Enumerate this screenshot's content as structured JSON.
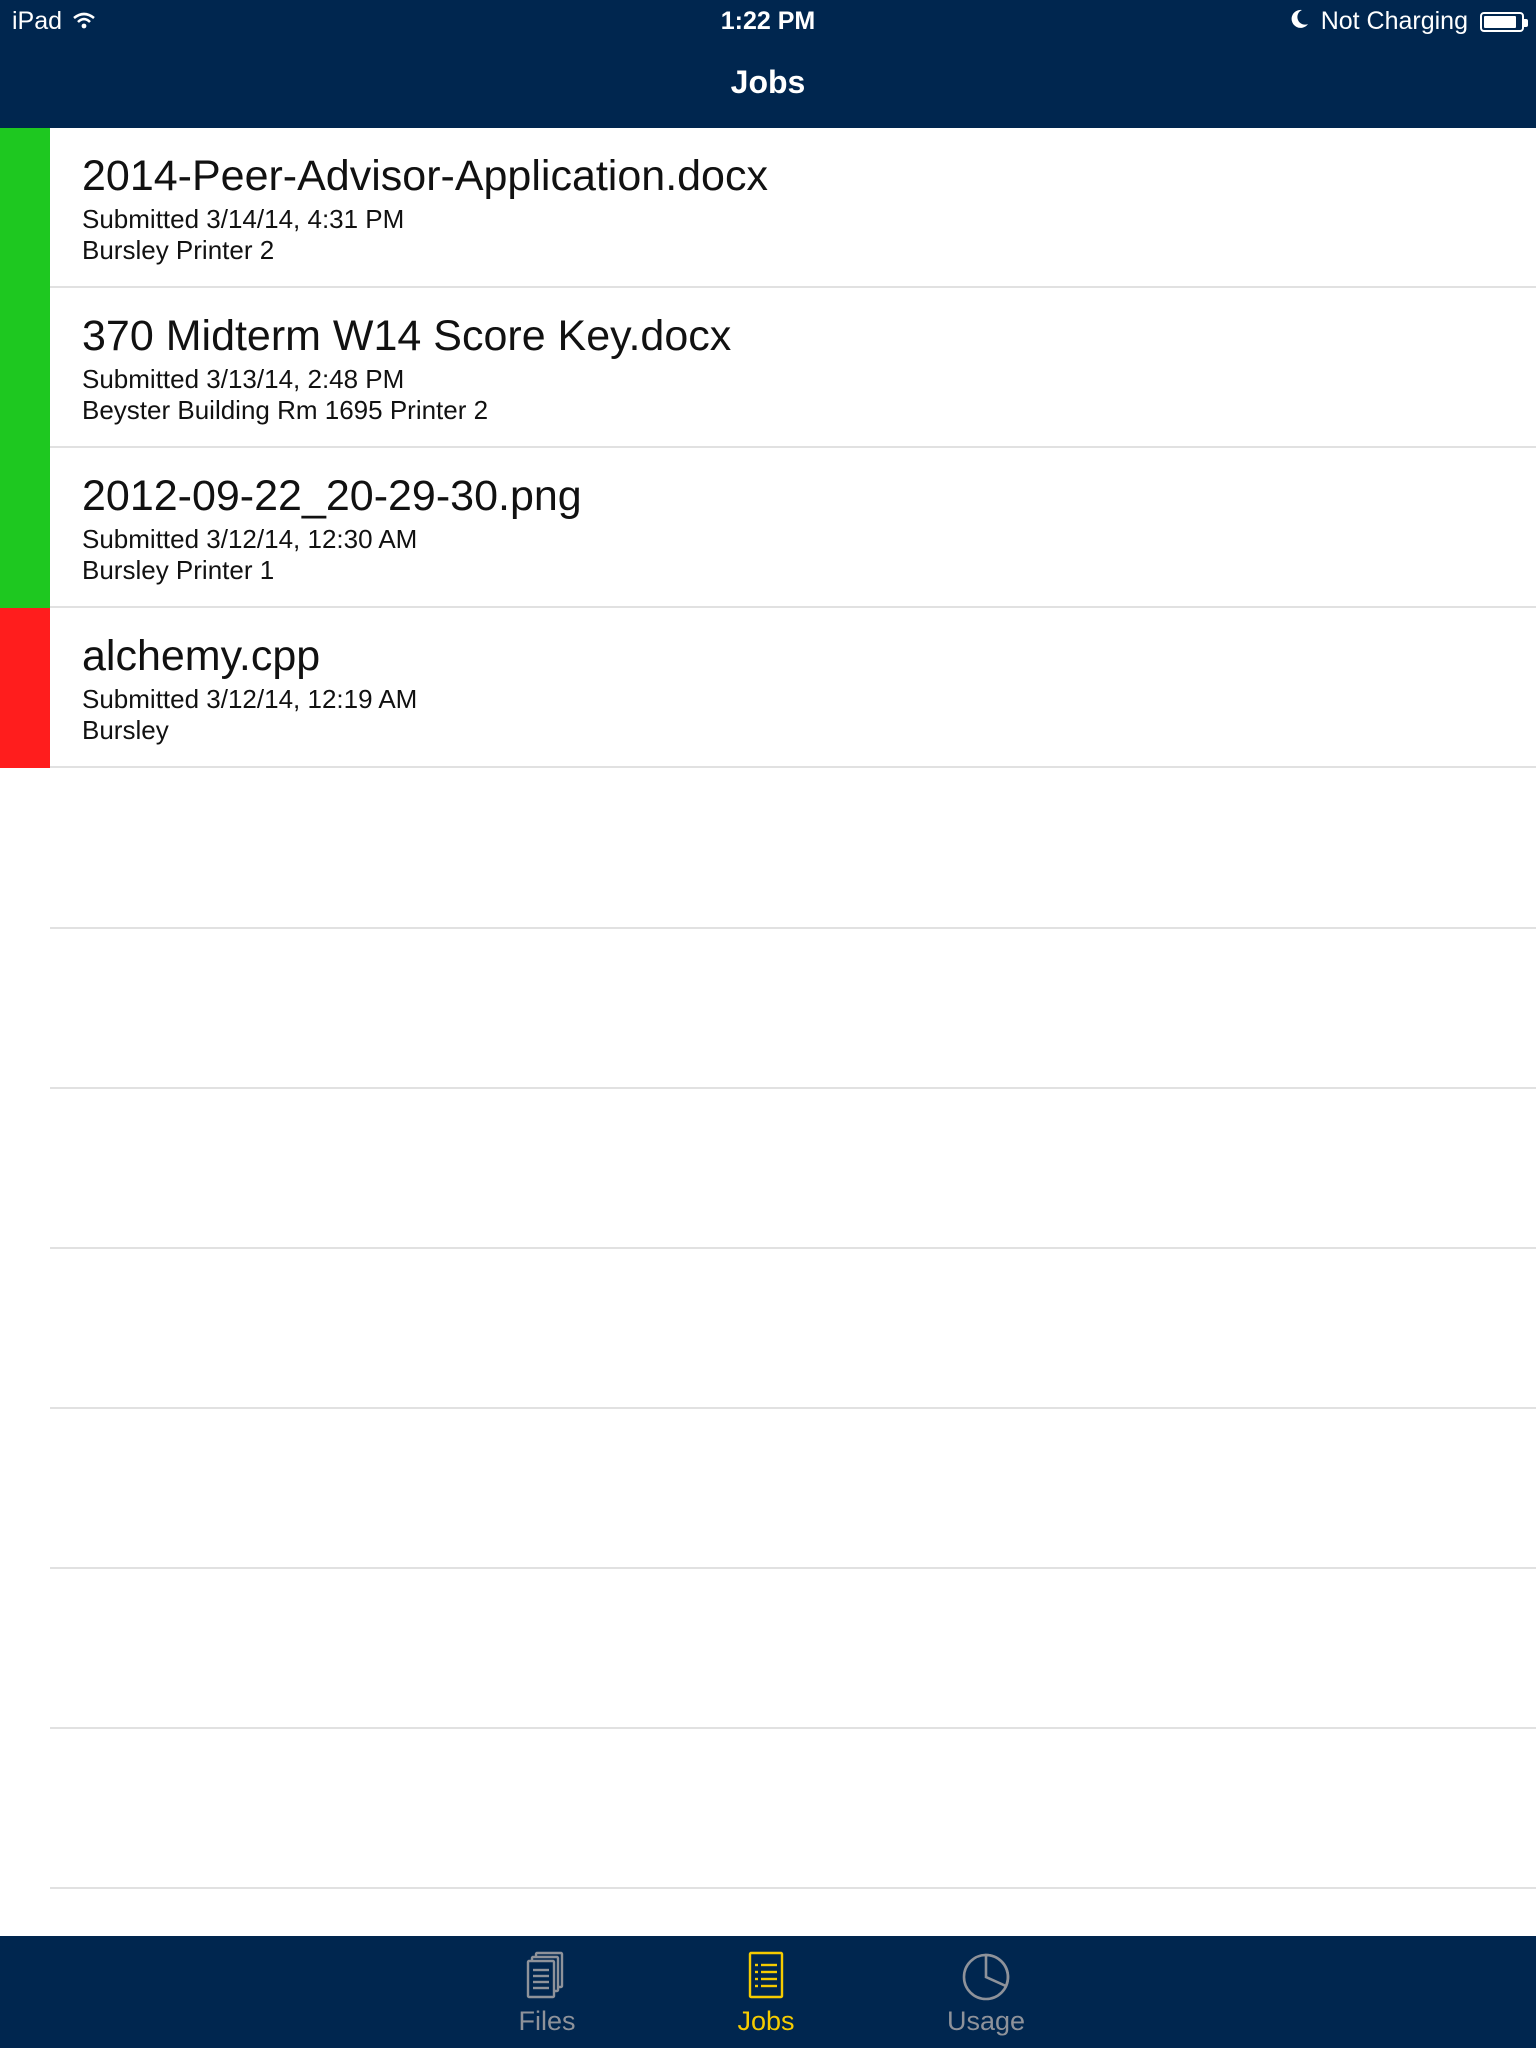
{
  "status_bar": {
    "device": "iPad",
    "time": "1:22 PM",
    "charging": "Not Charging",
    "battery_level": 0.9
  },
  "nav": {
    "title": "Jobs"
  },
  "jobs": [
    {
      "name": "2014-Peer-Advisor-Application.docx",
      "submitted": "Submitted 3/14/14, 4:31 PM",
      "printer": "Bursley Printer 2",
      "status_color": "#1ec820"
    },
    {
      "name": "370 Midterm W14 Score Key.docx",
      "submitted": "Submitted 3/13/14, 2:48 PM",
      "printer": "Beyster Building Rm 1695 Printer 2",
      "status_color": "#1ec820"
    },
    {
      "name": "2012-09-22_20-29-30.png",
      "submitted": "Submitted 3/12/14, 12:30 AM",
      "printer": "Bursley Printer 1",
      "status_color": "#1ec820"
    },
    {
      "name": "alchemy.cpp",
      "submitted": "Submitted 3/12/14, 12:19 AM",
      "printer": "Bursley",
      "status_color": "#ff1d1d"
    }
  ],
  "tabs": [
    {
      "label": "Files",
      "icon": "files-icon",
      "selected": false
    },
    {
      "label": "Jobs",
      "icon": "jobs-icon",
      "selected": true
    },
    {
      "label": "Usage",
      "icon": "usage-pie-icon",
      "selected": false
    }
  ],
  "colors": {
    "bar_background": "#00264f",
    "tab_selected": "#f5cb00",
    "tab_unselected": "#8e929a",
    "success": "#1ec820",
    "error": "#ff1d1d"
  }
}
